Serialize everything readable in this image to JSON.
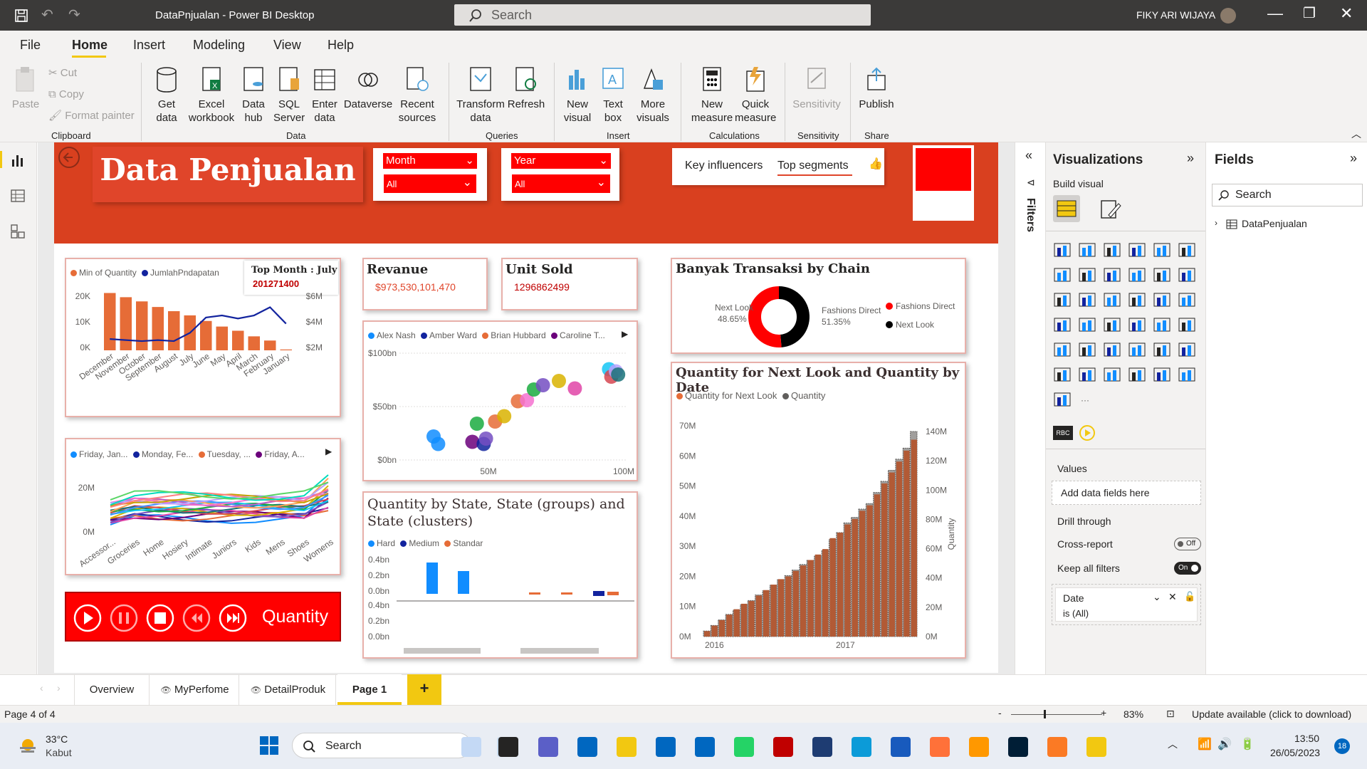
{
  "window": {
    "title": "DataPnjualan - Power BI Desktop",
    "search_placeholder": "Search",
    "user": "FIKY ARI WIJAYA"
  },
  "menu": [
    "File",
    "Home",
    "Insert",
    "Modeling",
    "View",
    "Help"
  ],
  "ribbon": {
    "clipboard": {
      "paste": "Paste",
      "cut": "Cut",
      "copy": "Copy",
      "format_painter": "Format painter",
      "group": "Clipboard"
    },
    "data": {
      "get_data": "Get data",
      "excel": "Excel workbook",
      "data_hub": "Data hub",
      "sql": "SQL Server",
      "enter": "Enter data",
      "dataverse": "Dataverse",
      "recent": "Recent sources",
      "group": "Data"
    },
    "queries": {
      "transform": "Transform data",
      "refresh": "Refresh",
      "group": "Queries"
    },
    "insert": {
      "new_visual": "New visual",
      "text_box": "Text box",
      "more_visuals": "More visuals",
      "group": "Insert"
    },
    "calc": {
      "new_measure": "New measure",
      "quick_measure": "Quick measure",
      "group": "Calculations"
    },
    "sens": {
      "sensitivity": "Sensitivity",
      "group": "Sensitivity"
    },
    "share": {
      "publish": "Publish",
      "group": "Share"
    }
  },
  "report": {
    "title": "Data Penjualan",
    "slicer_month": {
      "label": "Month",
      "value": "All"
    },
    "slicer_year": {
      "label": "Year",
      "value": "All"
    },
    "ai_tabs": [
      "Key influencers",
      "Top segments"
    ],
    "revenue": {
      "title": "Revanue",
      "value": "$973,530,101,470"
    },
    "unit_sold": {
      "title": "Unit Sold",
      "value": "1296862499"
    },
    "top_month": {
      "label": "Top Month : July",
      "value": "201271400"
    },
    "chain": {
      "title": "Banyak Transaksi by Chain",
      "legend": [
        "Fashions Direct",
        "Next Look"
      ],
      "labels": [
        {
          "name": "Next Look",
          "pct": "48.65%"
        },
        {
          "name": "Fashions Direct",
          "pct": "51.35%"
        }
      ]
    },
    "qty_date_title": "Quantity for Next Look and Quantity by Date",
    "state_title": "Quantity by State, State (groups) and State (clusters)",
    "play": {
      "label": "Quantity"
    }
  },
  "chart_data": [
    {
      "type": "bar",
      "name": "min-quantity-by-month",
      "categories": [
        "December",
        "November",
        "October",
        "September",
        "August",
        "July",
        "June",
        "May",
        "April",
        "March",
        "February",
        "January"
      ],
      "series": [
        {
          "name": "Min of Quantity",
          "values": [
            20500,
            19000,
            17500,
            15500,
            14000,
            12500,
            10500,
            8500,
            7000,
            5000,
            3500,
            300
          ]
        },
        {
          "name": "JumlahPndapatan",
          "values": [
            2.6,
            2.5,
            2.4,
            2.5,
            2.4,
            3.2,
            4.7,
            4.9,
            4.6,
            4.9,
            5.7,
            4.1
          ]
        }
      ],
      "yticks": [
        "20K",
        "10K",
        "0K"
      ],
      "y2ticks": [
        "$6M",
        "$4M",
        "$2M"
      ]
    },
    {
      "type": "scatter",
      "name": "revenue-by-salesperson",
      "legend": [
        "Alex Nash",
        "Amber Ward",
        "Brian Hubbard",
        "Caroline T..."
      ],
      "yticks": [
        "$100bn",
        "$50bn",
        "$0bn"
      ],
      "xticks": [
        "50M",
        "100M"
      ],
      "x": [
        15,
        17,
        32,
        34,
        37,
        38,
        42,
        46,
        52,
        56,
        59,
        63,
        70,
        77,
        92,
        93,
        95,
        96
      ],
      "y": [
        22,
        15,
        17,
        34,
        15,
        20,
        36,
        41,
        55,
        56,
        66,
        70,
        74,
        67,
        85,
        78,
        83,
        80
      ]
    },
    {
      "type": "area",
      "name": "quantity-by-day-category",
      "legend": [
        "Friday, Jan...",
        "Monday, Fe...",
        "Tuesday, ...",
        "Friday, A..."
      ],
      "categories": [
        "Accessor...",
        "Groceries",
        "Home",
        "Hosiery",
        "Intimate",
        "Juniors",
        "Kids",
        "Mens",
        "Shoes",
        "Womens"
      ],
      "yticks": [
        "20M",
        "0M"
      ]
    },
    {
      "type": "bar",
      "name": "quantity-by-state",
      "legend": [
        "Hard",
        "Medium",
        "Standar"
      ],
      "yticks": [
        "0.4bn",
        "0.2bn",
        "0.0bn",
        "0.4bn",
        "0.2bn",
        "0.0bn"
      ]
    },
    {
      "type": "pie",
      "name": "transactions-by-chain",
      "categories": [
        "Next Look",
        "Fashions Direct"
      ],
      "values": [
        48.65,
        51.35
      ]
    },
    {
      "type": "bar",
      "name": "quantity-by-date",
      "legend": [
        "Quantity for Next Look",
        "Quantity"
      ],
      "yticks": [
        "70M",
        "60M",
        "50M",
        "40M",
        "30M",
        "20M",
        "10M",
        "0M"
      ],
      "y2ticks": [
        "140M",
        "120M",
        "100M",
        "80M",
        "60M",
        "40M",
        "20M",
        "0M"
      ],
      "xticks": [
        "2016",
        "2017"
      ],
      "y2label": "Quantity",
      "values": [
        2,
        4,
        6,
        8,
        10,
        12,
        13,
        15,
        17,
        19,
        21,
        22,
        24,
        26,
        28,
        30,
        32,
        36,
        38,
        41,
        43,
        46,
        48,
        52,
        56,
        60,
        64,
        68,
        72
      ],
      "values2": [
        4,
        8,
        12,
        16,
        19,
        23,
        26,
        30,
        33,
        37,
        41,
        44,
        48,
        52,
        55,
        58,
        62,
        70,
        75,
        82,
        86,
        92,
        96,
        104,
        112,
        120,
        128,
        136,
        148
      ]
    }
  ],
  "panes": {
    "filters": "Filters",
    "visualizations": "Visualizations",
    "build_visual": "Build visual",
    "fields": "Fields",
    "fields_search": "Search",
    "table": "DataPenjualan",
    "values_label": "Values",
    "values_placeholder": "Add data fields here",
    "drill": "Drill through",
    "cross_report": "Cross-report",
    "cross_state": "Off",
    "keep_filters": "Keep all filters",
    "keep_state": "On",
    "filter_field": "Date",
    "filter_value": "is (All)"
  },
  "tabs": [
    "Overview",
    "MyPerfome",
    "DetailProduk",
    "Page 1"
  ],
  "status": {
    "page": "Page 4 of 4",
    "zoom": "83%",
    "update": "Update available (click to download)"
  },
  "taskbar": {
    "temp": "33°C",
    "weather": "Kabut",
    "search": "Search",
    "time": "13:50",
    "date": "26/05/2023",
    "notif": "18"
  },
  "colors": {
    "accent": "#d9401f",
    "red": "#ff0000",
    "bar": "#e66c37",
    "line": "#12239e"
  }
}
